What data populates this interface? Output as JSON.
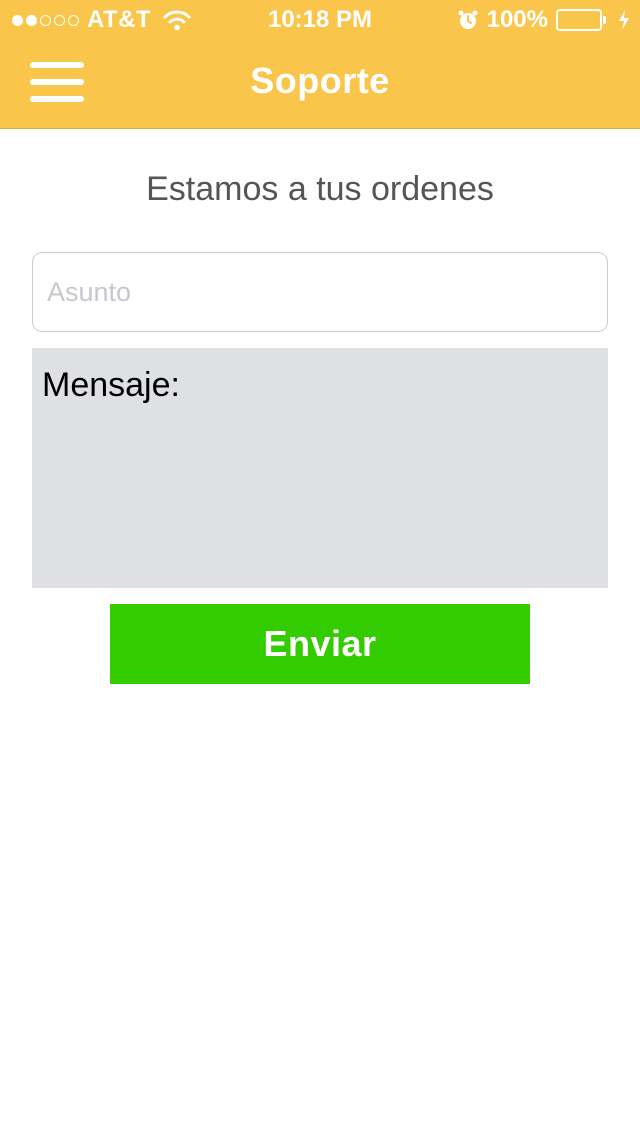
{
  "status_bar": {
    "carrier": "AT&T",
    "time": "10:18 PM",
    "battery": "100%",
    "signal_bars_filled": 2,
    "signal_bars_total": 5,
    "battery_level": 1.0
  },
  "header": {
    "title": "Soporte",
    "background_color": "#f9c54b",
    "menu_icon": "hamburger-menu-icon"
  },
  "main": {
    "tagline": "Estamos a tus ordenes",
    "subject_placeholder": "Asunto",
    "subject_value": "",
    "message_value": "Mensaje:",
    "send_label": "Enviar",
    "send_color": "#33cc00"
  }
}
